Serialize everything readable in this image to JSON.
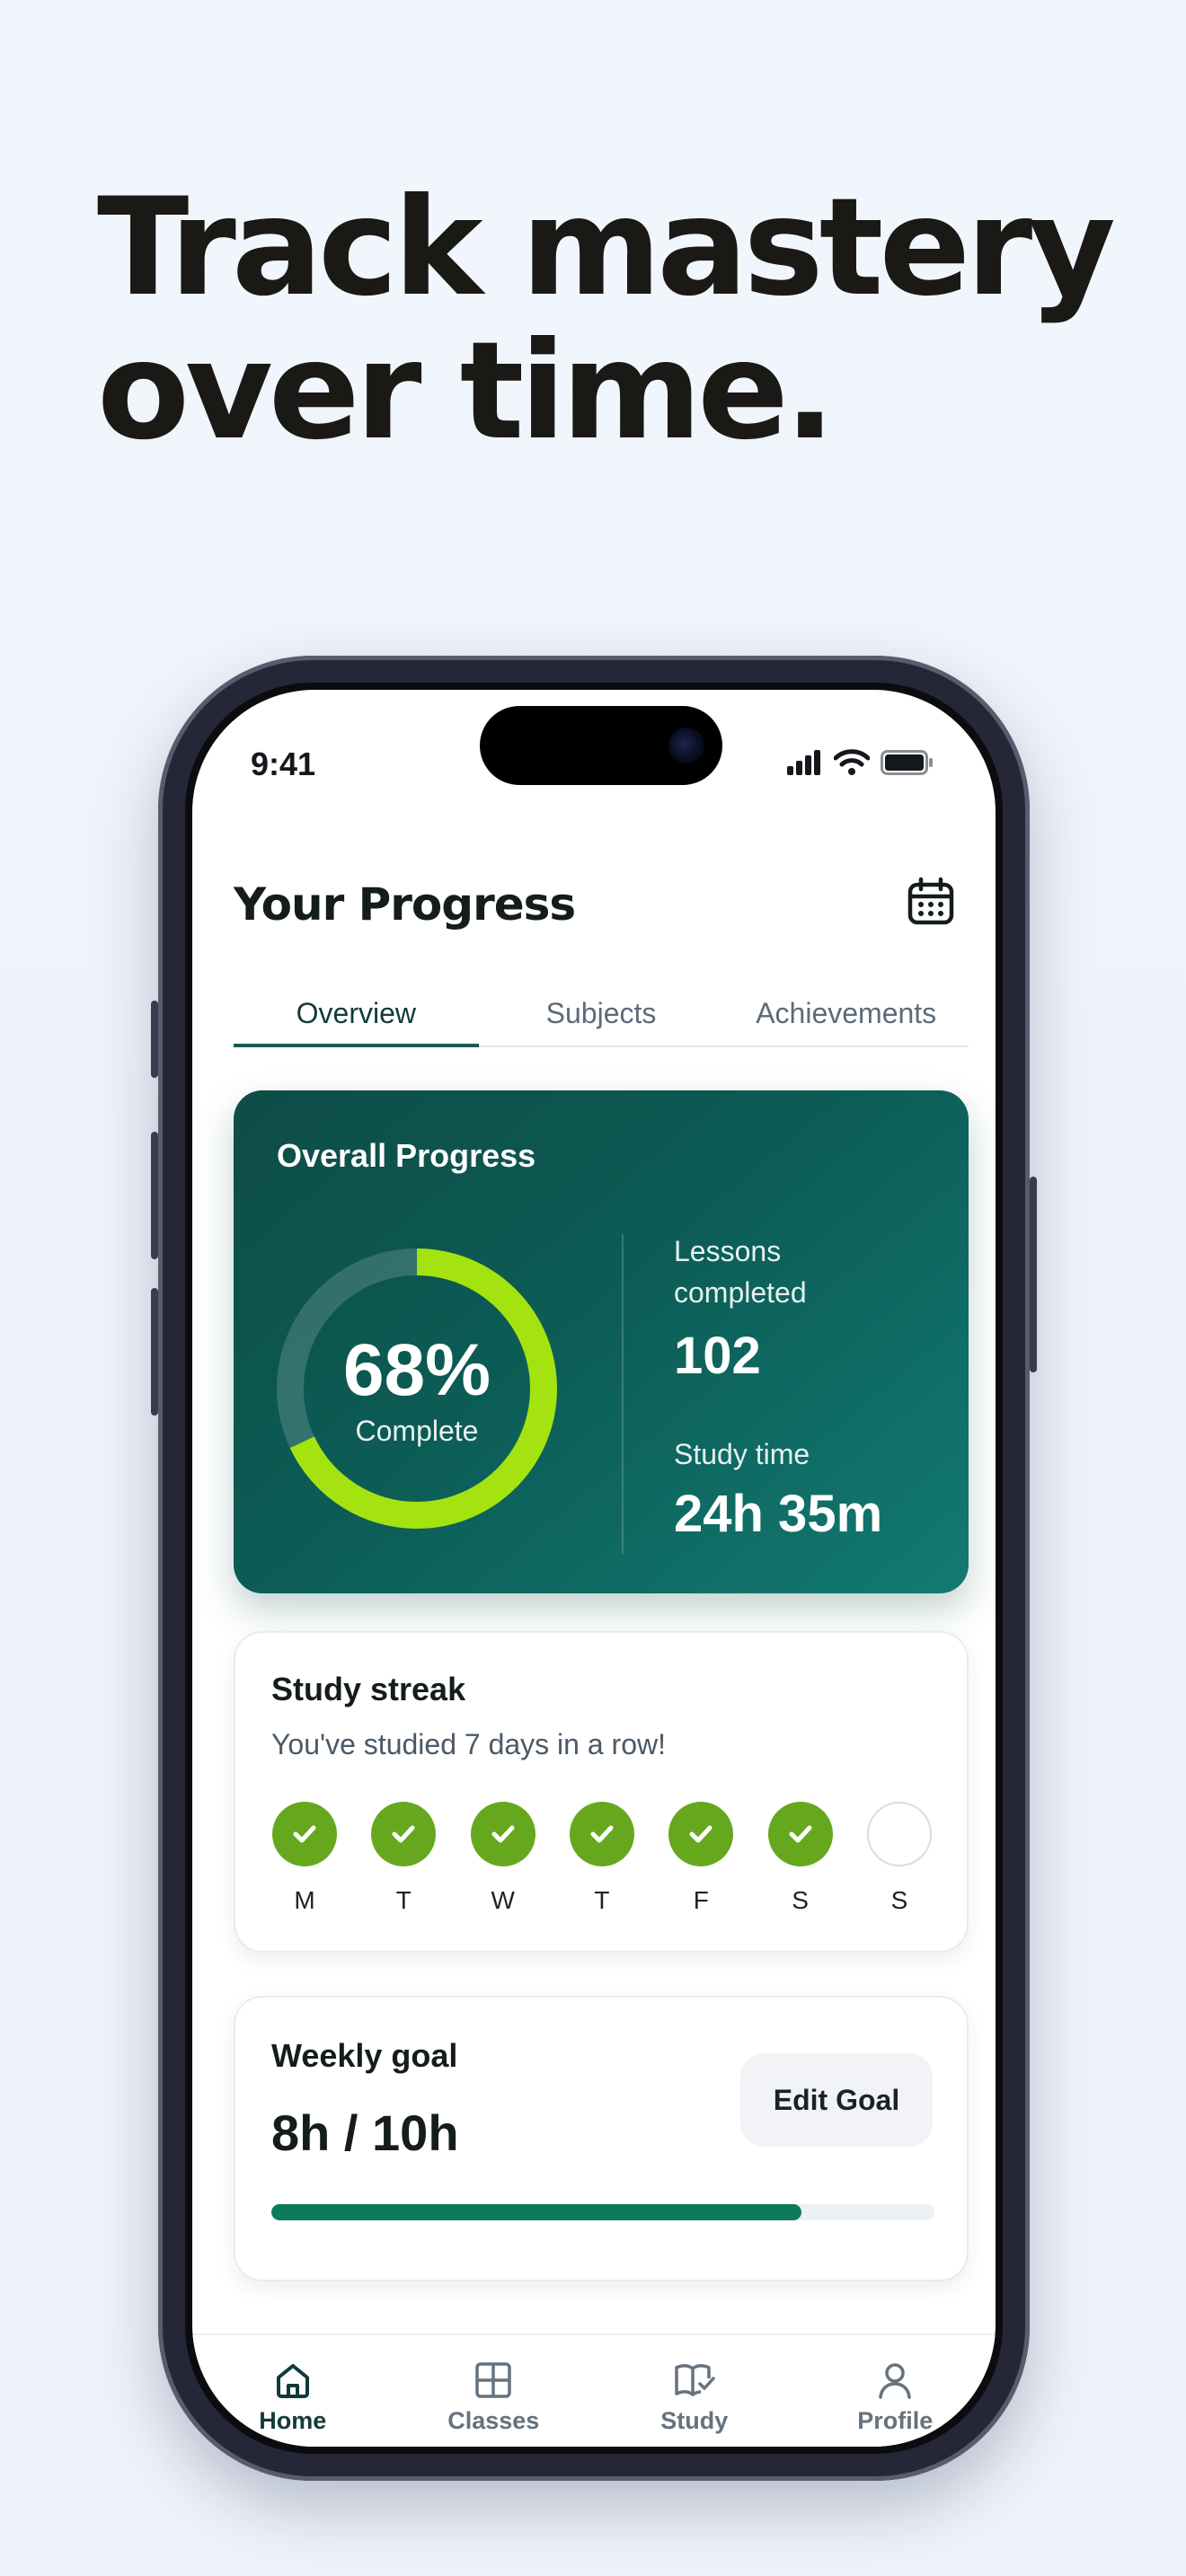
{
  "headline": {
    "line1": "Track mastery",
    "line2": "over time."
  },
  "status_bar": {
    "time": "9:41"
  },
  "page": {
    "title": "Your Progress"
  },
  "tabs": [
    {
      "label": "Overview",
      "active": true
    },
    {
      "label": "Subjects",
      "active": false
    },
    {
      "label": "Achievements",
      "active": false
    }
  ],
  "overall_progress": {
    "title": "Overall Progress",
    "percent_label": "68%",
    "percent_value": 0.68,
    "complete_label": "Complete",
    "lessons_label": "Lessons completed",
    "lessons_value": "102",
    "study_time_label": "Study time",
    "study_time_value": "24h 35m",
    "ring_color": "#a4e30f"
  },
  "study_streak": {
    "title": "Study streak",
    "subtitle": "You've studied 7 days in a row!",
    "days": [
      {
        "label": "M",
        "done": true
      },
      {
        "label": "T",
        "done": true
      },
      {
        "label": "W",
        "done": true
      },
      {
        "label": "T",
        "done": true
      },
      {
        "label": "F",
        "done": true
      },
      {
        "label": "S",
        "done": true
      },
      {
        "label": "S",
        "done": false
      }
    ]
  },
  "weekly_goal": {
    "title": "Weekly goal",
    "value": "8h / 10h",
    "progress": 0.8,
    "edit_label": "Edit Goal"
  },
  "nav": [
    {
      "label": "Home",
      "icon": "home-icon",
      "active": true
    },
    {
      "label": "Classes",
      "icon": "grid-icon",
      "active": false
    },
    {
      "label": "Study",
      "icon": "book-check-icon",
      "active": false
    },
    {
      "label": "Profile",
      "icon": "user-icon",
      "active": false
    }
  ],
  "colors": {
    "brand_dark": "#0f4c47",
    "accent_green": "#66a81d",
    "goal_bar": "#0c7a58"
  }
}
